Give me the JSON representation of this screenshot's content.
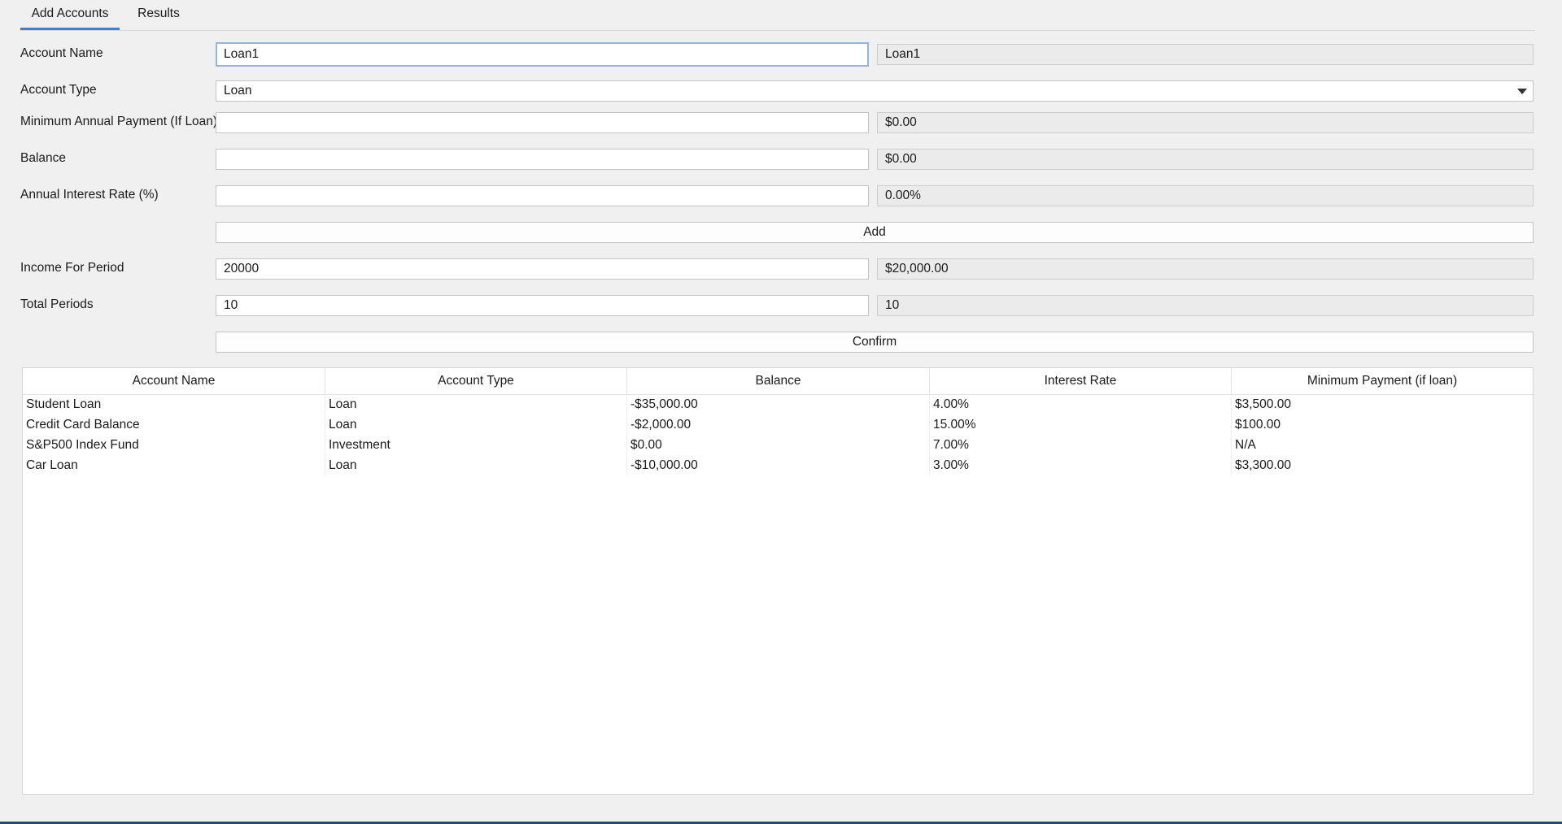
{
  "tabs": [
    {
      "label": "Add Accounts"
    },
    {
      "label": "Results"
    }
  ],
  "form": {
    "account_name": {
      "label": "Account Name",
      "value": "Loan1",
      "echo": "Loan1"
    },
    "account_type": {
      "label": "Account Type",
      "selected": "Loan"
    },
    "min_payment": {
      "label": "Minimum Annual Payment (If Loan)",
      "value": "",
      "echo": "$0.00"
    },
    "balance": {
      "label": "Balance",
      "value": "",
      "echo": "$0.00"
    },
    "interest_rate": {
      "label": "Annual Interest Rate (%)",
      "value": "",
      "echo": "0.00%"
    },
    "add_label": "Add",
    "income": {
      "label": "Income For Period",
      "value": "20000",
      "echo": "$20,000.00"
    },
    "total_periods": {
      "label": "Total Periods",
      "value": "10",
      "echo": "10"
    },
    "confirm_label": "Confirm"
  },
  "table": {
    "columns": [
      "Account Name",
      "Account Type",
      "Balance",
      "Interest Rate",
      "Minimum Payment (if loan)"
    ],
    "rows": [
      [
        "Student Loan",
        "Loan",
        "-$35,000.00",
        "4.00%",
        "$3,500.00"
      ],
      [
        "Credit Card Balance",
        "Loan",
        "-$2,000.00",
        "15.00%",
        "$100.00"
      ],
      [
        "S&P500 Index Fund",
        "Investment",
        "$0.00",
        "7.00%",
        "N/A"
      ],
      [
        "Car Loan",
        "Loan",
        "-$10,000.00",
        "3.00%",
        "$3,300.00"
      ]
    ]
  }
}
